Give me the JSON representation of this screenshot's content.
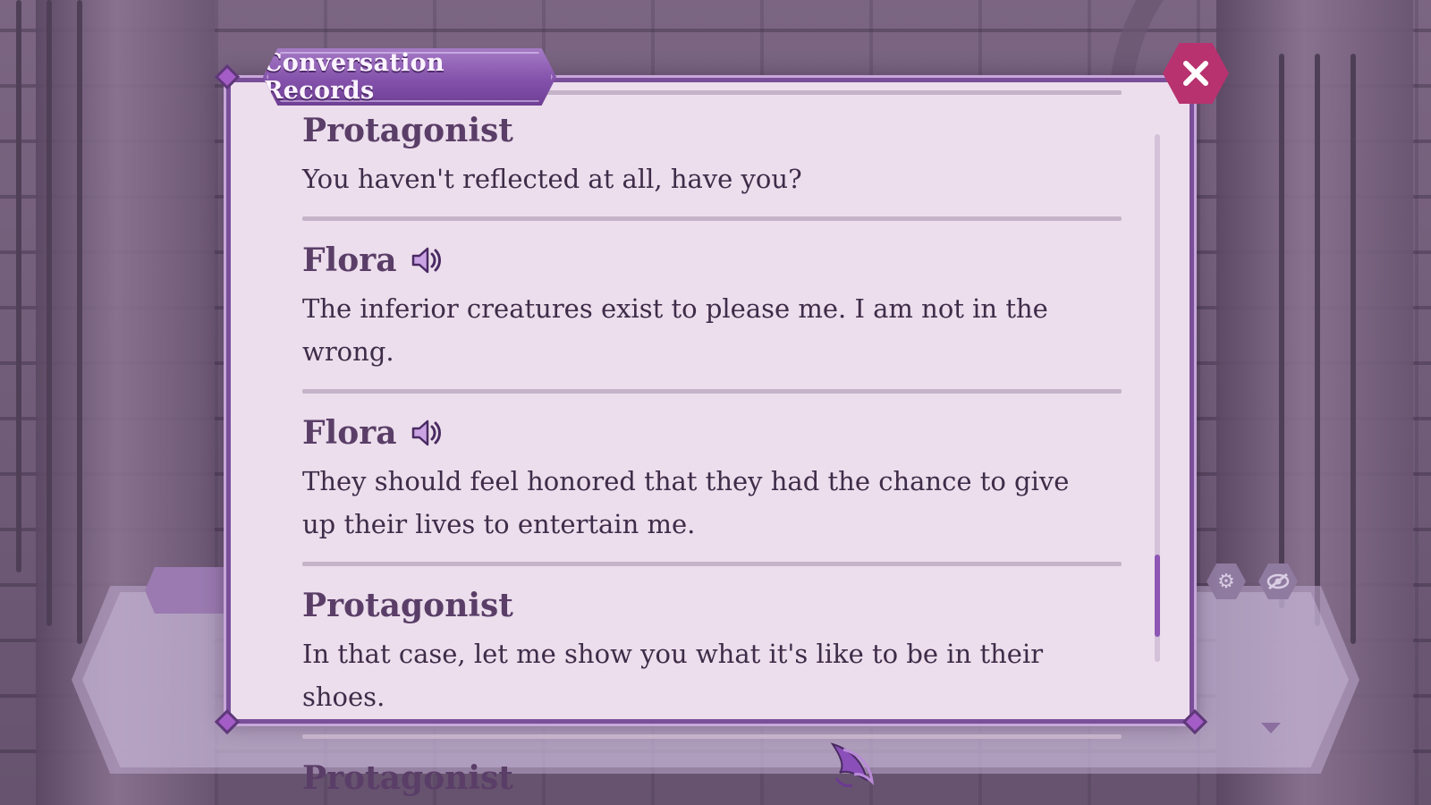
{
  "window": {
    "title": "Conversation Records",
    "close_icon": "close-icon"
  },
  "records": [
    {
      "speaker": "Protagonist",
      "has_voice": false,
      "text": "You haven't reflected at all, have you?"
    },
    {
      "speaker": "Flora",
      "has_voice": true,
      "text": "The inferior creatures exist to please me. I am not in the wrong."
    },
    {
      "speaker": "Flora",
      "has_voice": true,
      "text": "They should feel honored that they had the chance to give up their lives to entertain me."
    },
    {
      "speaker": "Protagonist",
      "has_voice": false,
      "text": "In that case, let me show you what it's like to be in their shoes."
    },
    {
      "speaker": "Protagonist",
      "has_voice": false,
      "text": ""
    }
  ],
  "scroll": {
    "position_fraction": 0.9
  },
  "hud": {
    "settings_icon": "gear-icon",
    "hide_ui_icon": "eye-slash-icon",
    "advance_icon": "chevron-down-icon",
    "auto_icon": "quill-icon"
  },
  "colors": {
    "accent": "#8452ab",
    "close": "#b8326f",
    "panel": "#ecdeec",
    "speaker": "#5a3e68",
    "text": "#3f2c49"
  }
}
